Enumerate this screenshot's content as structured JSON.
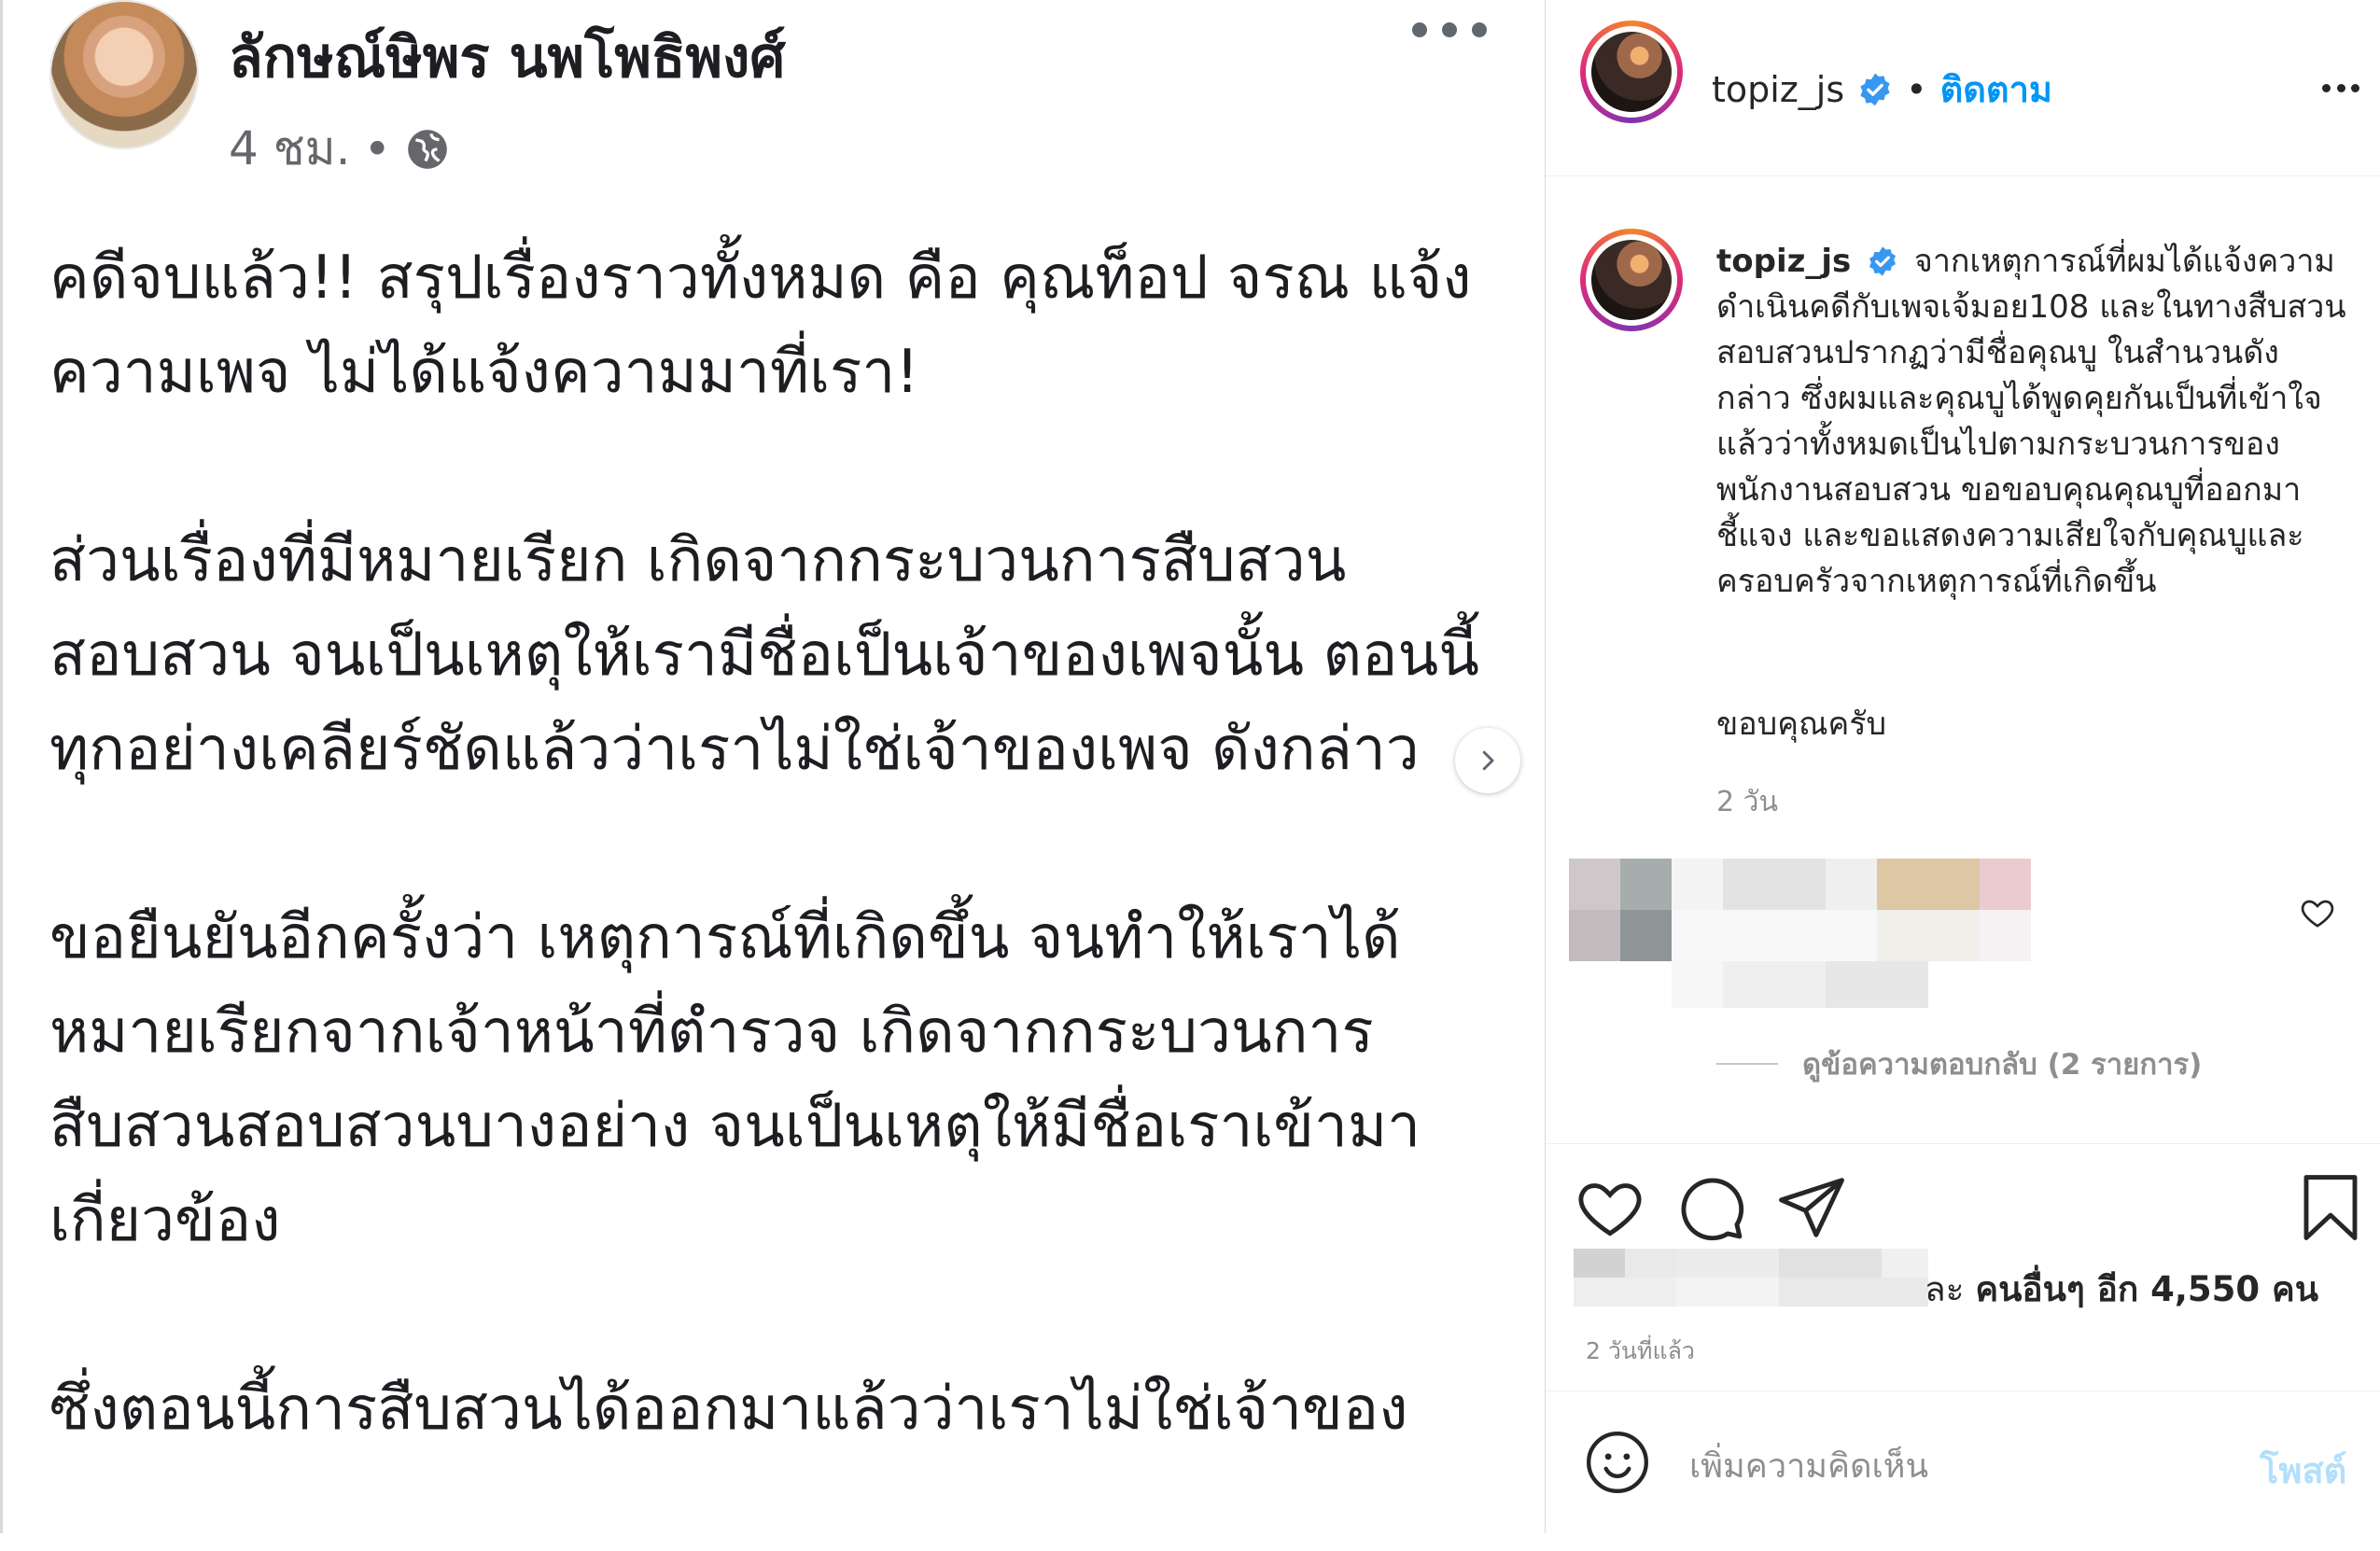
{
  "facebook_post": {
    "author_name": "ลักษณ์ษิพร นพโพธิพงศ์",
    "time": "4 ชม.",
    "separator": "•",
    "privacy_icon": "globe-icon",
    "more_icon": "more-horizontal-icon",
    "paragraphs": [
      "คดีจบแล้ว!! สรุปเรื่องราวทั้งหมด คือ คุณท็อป จรณ แจ้งความเพจ ไม่ได้แจ้งความมาที่เรา!",
      "ส่วนเรื่องที่มีหมายเรียก เกิดจากกระบวนการสืบสวน สอบสวน จนเป็นเหตุให้เรามีชื่อเป็นเจ้าของเพจนั้น ตอนนี้ทุกอย่างเคลียร์ชัดแล้วว่าเราไม่ใช่เจ้าของเพจ ดังกล่าว",
      "ขอยืนยันอีกครั้งว่า เหตุการณ์ที่เกิดขึ้น จนทำให้เราได้ หมายเรียกจากเจ้าหน้าที่ตำรวจ เกิดจากกระบวนการ สืบสวนสอบสวนบางอย่าง จนเป็นเหตุให้มีชื่อเราเข้ามา เกี่ยวข้อง",
      "ซึ่งตอนนี้การสืบสวนได้ออกมาแล้วว่าเราไม่ใช่เจ้าของ"
    ],
    "next_icon": "chevron-right-icon"
  },
  "instagram_post": {
    "username": "topiz_js",
    "verified_icon": "verified-badge-icon",
    "dot": "•",
    "follow_label": "ติดตาม",
    "caption_username": "topiz_js",
    "caption_text": "จากเหตุการณ์ที่ผมได้แจ้งความดำเนินคดีกับเพจเจ้มอย108 และในทางสืบสวนสอบสวนปรากฏว่ามีชื่อคุณบู ในสำนวนดังกล่าว ซึ่งผมและคุณบูได้พูดคุยกันเป็นที่เข้าใจแล้วว่าทั้งหมดเป็นไปตามกระบวนการของพนักงานสอบสวน ขอขอบคุณคุณบูที่ออกมาชี้แจง และขอแสดงความเสียใจกับคุณบูและครอบครัวจากเหตุการณ์ที่เกิดขึ้น",
    "caption_thanks": "ขอบคุณครับ",
    "caption_time": "2 วัน",
    "view_replies": "ดูข้อความตอบกลับ (2 รายการ)",
    "likes_prefix": "ละ ",
    "likes_bold": "คนอื่นๆ อีก 4,550 คน",
    "post_time": "2 วันที่แล้ว",
    "comment_placeholder": "เพิ่มความคิดเห็น",
    "post_button": "โพสต์",
    "icons": [
      "heart-icon",
      "comment-icon",
      "share-icon",
      "bookmark-icon",
      "emoji-icon"
    ],
    "colors": {
      "link_blue": "#0095f6",
      "post_disabled": "#b2dffc",
      "muted": "#8e8e8e"
    }
  }
}
